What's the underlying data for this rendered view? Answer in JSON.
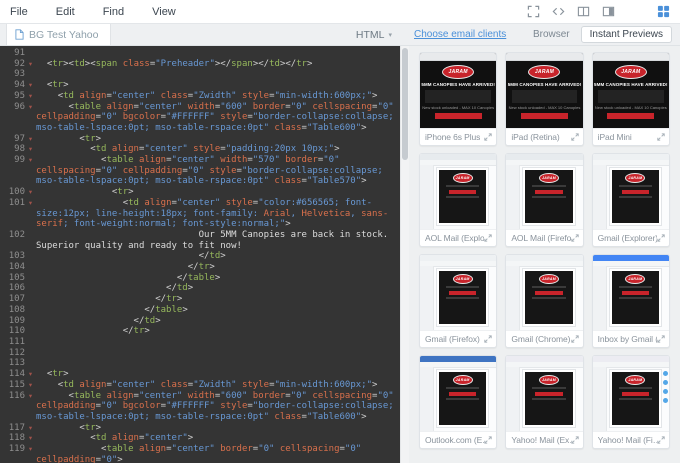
{
  "menubar": {
    "items": [
      "File",
      "Edit",
      "Find",
      "View"
    ],
    "icon_names": [
      "fullscreen-icon",
      "code-view-icon",
      "split-view-icon",
      "layout-view-icon",
      "grid-view-icon"
    ]
  },
  "tabbar": {
    "tab_label": "BG Test Yahoo",
    "mode_label": "HTML"
  },
  "preview_header": {
    "link": "Choose email clients",
    "tabs": [
      {
        "label": "Browser",
        "active": false
      },
      {
        "label": "Instant Previews",
        "active": true
      }
    ]
  },
  "colors": {
    "accent_blue": "#4a90d9",
    "brand_red": "#c8242b",
    "editor_background": "#343434",
    "tag_green": "#96b85c",
    "attribute_orange": "#d9704c",
    "string_blue": "#6898d4"
  },
  "preview_email": {
    "brand": "JARAM",
    "banner": "5MM CANOPIES HAVE ARRIVED!",
    "subbanner": "New stock unloaded - MAX 10 Canopies"
  },
  "previews": [
    {
      "label": "iPhone 6s Plus",
      "type": "device"
    },
    {
      "label": "iPad (Retina)",
      "type": "device"
    },
    {
      "label": "iPad Mini",
      "type": "device"
    },
    {
      "label": "AOL Mail (Explore…",
      "type": "webmail",
      "chrome": "#e7ebee"
    },
    {
      "label": "AOL Mail (Firefox)",
      "type": "webmail",
      "chrome": "#e7ebee"
    },
    {
      "label": "Gmail (Explorer)",
      "type": "webmail",
      "chrome": "#eef1f3"
    },
    {
      "label": "Gmail (Firefox)",
      "type": "webmail",
      "chrome": "#eef1f3"
    },
    {
      "label": "Gmail (Chrome)",
      "type": "webmail",
      "chrome": "#eef1f3"
    },
    {
      "label": "Inbox by Gmail (…",
      "type": "webmail",
      "chrome": "#4285f4"
    },
    {
      "label": "Outlook.com (E…",
      "type": "webmail",
      "chrome": "#3f74c2"
    },
    {
      "label": "Yahoo! Mail (Ex…",
      "type": "webmail",
      "chrome": "#ececf2"
    },
    {
      "label": "Yahoo! Mail (Fi…",
      "type": "webmail",
      "chrome": "#ececf2",
      "dots": true
    }
  ],
  "editor": {
    "lines": [
      {
        "n": 91,
        "t": []
      },
      {
        "n": 92,
        "i": 2,
        "f": true,
        "t": [
          [
            "p",
            "<"
          ],
          [
            "g",
            "tr"
          ],
          [
            "p",
            "><"
          ],
          [
            "g",
            "td"
          ],
          [
            "p",
            "><"
          ],
          [
            "g",
            "span"
          ],
          [
            "p",
            " "
          ],
          [
            "a",
            "class"
          ],
          [
            "p",
            "="
          ],
          [
            "s",
            "\"Preheader\""
          ],
          [
            "p",
            "></"
          ],
          [
            "g",
            "span"
          ],
          [
            "p",
            "></"
          ],
          [
            "g",
            "td"
          ],
          [
            "p",
            "></"
          ],
          [
            "g",
            "tr"
          ],
          [
            "p",
            ">"
          ]
        ]
      },
      {
        "n": 93,
        "t": []
      },
      {
        "n": 94,
        "i": 2,
        "f": true,
        "t": [
          [
            "p",
            "<"
          ],
          [
            "g",
            "tr"
          ],
          [
            "p",
            ">"
          ]
        ]
      },
      {
        "n": 95,
        "i": 4,
        "f": true,
        "t": [
          [
            "p",
            "<"
          ],
          [
            "g",
            "td"
          ],
          [
            "p",
            " "
          ],
          [
            "a",
            "align"
          ],
          [
            "p",
            "="
          ],
          [
            "s",
            "\"center\""
          ],
          [
            "p",
            " "
          ],
          [
            "a",
            "class"
          ],
          [
            "p",
            "="
          ],
          [
            "s",
            "\"Zwidth\""
          ],
          [
            "p",
            " "
          ],
          [
            "a",
            "style"
          ],
          [
            "p",
            "="
          ],
          [
            "s",
            "\"min-width:600px;\""
          ],
          [
            "p",
            ">"
          ]
        ]
      },
      {
        "n": 96,
        "i": 6,
        "f": true,
        "t": [
          [
            "p",
            "<"
          ],
          [
            "g",
            "table"
          ],
          [
            "p",
            " "
          ],
          [
            "a",
            "align"
          ],
          [
            "p",
            "="
          ],
          [
            "s",
            "\"center\""
          ],
          [
            "p",
            " "
          ],
          [
            "a",
            "width"
          ],
          [
            "p",
            "="
          ],
          [
            "s",
            "\"600\""
          ],
          [
            "p",
            " "
          ],
          [
            "a",
            "border"
          ],
          [
            "p",
            "="
          ],
          [
            "s",
            "\"0\""
          ],
          [
            "p",
            " "
          ],
          [
            "a",
            "cellspacing"
          ],
          [
            "p",
            "="
          ],
          [
            "s",
            "\"0\""
          ],
          [
            "p",
            " "
          ],
          [
            "a",
            "cellpadding"
          ],
          [
            "p",
            "="
          ],
          [
            "s",
            "\"0\""
          ],
          [
            "p",
            " "
          ],
          [
            "a",
            "bgcolor"
          ],
          [
            "p",
            "="
          ],
          [
            "s",
            "\"#FFFFFF\""
          ],
          [
            "p",
            " "
          ],
          [
            "a",
            "style"
          ],
          [
            "p",
            "="
          ],
          [
            "s",
            "\"border-collapse:collapse; mso-table-lspace:0pt; mso-table-rspace:0pt\""
          ],
          [
            "p",
            " "
          ],
          [
            "a",
            "class"
          ],
          [
            "p",
            "="
          ],
          [
            "s",
            "\"Table600\""
          ],
          [
            "p",
            ">"
          ]
        ]
      },
      {
        "n": 97,
        "i": 8,
        "f": true,
        "t": [
          [
            "p",
            "<"
          ],
          [
            "g",
            "tr"
          ],
          [
            "p",
            ">"
          ]
        ]
      },
      {
        "n": 98,
        "i": 10,
        "f": true,
        "t": [
          [
            "p",
            "<"
          ],
          [
            "g",
            "td"
          ],
          [
            "p",
            " "
          ],
          [
            "a",
            "align"
          ],
          [
            "p",
            "="
          ],
          [
            "s",
            "\"center\""
          ],
          [
            "p",
            " "
          ],
          [
            "a",
            "style"
          ],
          [
            "p",
            "="
          ],
          [
            "s",
            "\"padding:20px 10px;\""
          ],
          [
            "p",
            ">"
          ]
        ]
      },
      {
        "n": 99,
        "i": 12,
        "f": true,
        "t": [
          [
            "p",
            "<"
          ],
          [
            "g",
            "table"
          ],
          [
            "p",
            " "
          ],
          [
            "a",
            "align"
          ],
          [
            "p",
            "="
          ],
          [
            "s",
            "\"center\""
          ],
          [
            "p",
            " "
          ],
          [
            "a",
            "width"
          ],
          [
            "p",
            "="
          ],
          [
            "s",
            "\"570\""
          ],
          [
            "p",
            " "
          ],
          [
            "a",
            "border"
          ],
          [
            "p",
            "="
          ],
          [
            "s",
            "\"0\""
          ],
          [
            "p",
            " "
          ],
          [
            "a",
            "cellspacing"
          ],
          [
            "p",
            "="
          ],
          [
            "s",
            "\"0\""
          ],
          [
            "p",
            " "
          ],
          [
            "a",
            "cellpadding"
          ],
          [
            "p",
            "="
          ],
          [
            "s",
            "\"0\""
          ],
          [
            "p",
            " "
          ],
          [
            "a",
            "style"
          ],
          [
            "p",
            "="
          ],
          [
            "s",
            "\"border-collapse:collapse; mso-table-lspace:0pt; mso-table-rspace:0pt\""
          ],
          [
            "p",
            " "
          ],
          [
            "a",
            "class"
          ],
          [
            "p",
            "="
          ],
          [
            "s",
            "\"Table570\""
          ],
          [
            "p",
            ">"
          ]
        ]
      },
      {
        "n": 100,
        "i": 14,
        "f": true,
        "t": [
          [
            "p",
            "<"
          ],
          [
            "g",
            "tr"
          ],
          [
            "p",
            ">"
          ]
        ]
      },
      {
        "n": 101,
        "i": 16,
        "f": true,
        "t": [
          [
            "p",
            "<"
          ],
          [
            "g",
            "td"
          ],
          [
            "p",
            " "
          ],
          [
            "a",
            "align"
          ],
          [
            "p",
            "="
          ],
          [
            "s",
            "\"center\""
          ],
          [
            "p",
            " "
          ],
          [
            "a",
            "style"
          ],
          [
            "p",
            "="
          ],
          [
            "s",
            "\"color:#656565; font-size:12px; line-height:18px; font-family: "
          ],
          [
            "c",
            "Arial"
          ],
          [
            "s",
            ", "
          ],
          [
            "c",
            "Helvetica"
          ],
          [
            "s",
            ", "
          ],
          [
            "c",
            "sans-serif"
          ],
          [
            "s",
            "; font-weight:normal; font-style:normal;\""
          ],
          [
            "p",
            ">"
          ]
        ]
      },
      {
        "n": 102,
        "i": 30,
        "t": [
          [
            "x",
            "Our 5MM Canopies are back in stock. Superior quality and ready to fit now!"
          ]
        ]
      },
      {
        "n": 103,
        "i": 30,
        "t": [
          [
            "p",
            "</"
          ],
          [
            "g",
            "td"
          ],
          [
            "p",
            ">"
          ]
        ]
      },
      {
        "n": 104,
        "i": 28,
        "t": [
          [
            "p",
            "</"
          ],
          [
            "g",
            "tr"
          ],
          [
            "p",
            ">"
          ]
        ]
      },
      {
        "n": 105,
        "i": 26,
        "t": [
          [
            "p",
            "</"
          ],
          [
            "g",
            "table"
          ],
          [
            "p",
            ">"
          ]
        ]
      },
      {
        "n": 106,
        "i": 24,
        "t": [
          [
            "p",
            "</"
          ],
          [
            "g",
            "td"
          ],
          [
            "p",
            ">"
          ]
        ]
      },
      {
        "n": 107,
        "i": 22,
        "t": [
          [
            "p",
            "</"
          ],
          [
            "g",
            "tr"
          ],
          [
            "p",
            ">"
          ]
        ]
      },
      {
        "n": 108,
        "i": 20,
        "t": [
          [
            "p",
            "</"
          ],
          [
            "g",
            "table"
          ],
          [
            "p",
            ">"
          ]
        ]
      },
      {
        "n": 109,
        "i": 18,
        "t": [
          [
            "p",
            "</"
          ],
          [
            "g",
            "td"
          ],
          [
            "p",
            ">"
          ]
        ]
      },
      {
        "n": 110,
        "i": 16,
        "t": [
          [
            "p",
            "</"
          ],
          [
            "g",
            "tr"
          ],
          [
            "p",
            ">"
          ]
        ]
      },
      {
        "n": 111,
        "t": []
      },
      {
        "n": 112,
        "t": []
      },
      {
        "n": 113,
        "t": []
      },
      {
        "n": 114,
        "i": 2,
        "f": true,
        "t": [
          [
            "p",
            "<"
          ],
          [
            "g",
            "tr"
          ],
          [
            "p",
            ">"
          ]
        ]
      },
      {
        "n": 115,
        "i": 4,
        "f": true,
        "t": [
          [
            "p",
            "<"
          ],
          [
            "g",
            "td"
          ],
          [
            "p",
            " "
          ],
          [
            "a",
            "align"
          ],
          [
            "p",
            "="
          ],
          [
            "s",
            "\"center\""
          ],
          [
            "p",
            " "
          ],
          [
            "a",
            "class"
          ],
          [
            "p",
            "="
          ],
          [
            "s",
            "\"Zwidth\""
          ],
          [
            "p",
            " "
          ],
          [
            "a",
            "style"
          ],
          [
            "p",
            "="
          ],
          [
            "s",
            "\"min-width:600px;\""
          ],
          [
            "p",
            ">"
          ]
        ]
      },
      {
        "n": 116,
        "i": 6,
        "f": true,
        "t": [
          [
            "p",
            "<"
          ],
          [
            "g",
            "table"
          ],
          [
            "p",
            " "
          ],
          [
            "a",
            "align"
          ],
          [
            "p",
            "="
          ],
          [
            "s",
            "\"center\""
          ],
          [
            "p",
            " "
          ],
          [
            "a",
            "width"
          ],
          [
            "p",
            "="
          ],
          [
            "s",
            "\"600\""
          ],
          [
            "p",
            " "
          ],
          [
            "a",
            "border"
          ],
          [
            "p",
            "="
          ],
          [
            "s",
            "\"0\""
          ],
          [
            "p",
            " "
          ],
          [
            "a",
            "cellspacing"
          ],
          [
            "p",
            "="
          ],
          [
            "s",
            "\"0\""
          ],
          [
            "p",
            " "
          ],
          [
            "a",
            "cellpadding"
          ],
          [
            "p",
            "="
          ],
          [
            "s",
            "\"0\""
          ],
          [
            "p",
            " "
          ],
          [
            "a",
            "bgcolor"
          ],
          [
            "p",
            "="
          ],
          [
            "s",
            "\"#FFFFFF\""
          ],
          [
            "p",
            " "
          ],
          [
            "a",
            "style"
          ],
          [
            "p",
            "="
          ],
          [
            "s",
            "\"border-collapse:collapse; mso-table-lspace:0pt; mso-table-rspace:0pt\""
          ],
          [
            "p",
            " "
          ],
          [
            "a",
            "class"
          ],
          [
            "p",
            "="
          ],
          [
            "s",
            "\"Table600\""
          ],
          [
            "p",
            ">"
          ]
        ]
      },
      {
        "n": 117,
        "i": 8,
        "f": true,
        "t": [
          [
            "p",
            "<"
          ],
          [
            "g",
            "tr"
          ],
          [
            "p",
            ">"
          ]
        ]
      },
      {
        "n": 118,
        "i": 10,
        "f": true,
        "t": [
          [
            "p",
            "<"
          ],
          [
            "g",
            "td"
          ],
          [
            "p",
            " "
          ],
          [
            "a",
            "align"
          ],
          [
            "p",
            "="
          ],
          [
            "s",
            "\"center\""
          ],
          [
            "p",
            ">"
          ]
        ]
      },
      {
        "n": 119,
        "i": 12,
        "f": true,
        "t": [
          [
            "p",
            "<"
          ],
          [
            "g",
            "table"
          ],
          [
            "p",
            " "
          ],
          [
            "a",
            "align"
          ],
          [
            "p",
            "="
          ],
          [
            "s",
            "\"center\""
          ],
          [
            "p",
            " "
          ],
          [
            "a",
            "border"
          ],
          [
            "p",
            "="
          ],
          [
            "s",
            "\"0\""
          ],
          [
            "p",
            " "
          ],
          [
            "a",
            "cellspacing"
          ],
          [
            "p",
            "="
          ],
          [
            "s",
            "\"0\""
          ],
          [
            "p",
            " "
          ],
          [
            "a",
            "cellpadding"
          ],
          [
            "p",
            "="
          ],
          [
            "s",
            "\"0\""
          ],
          [
            "p",
            ">"
          ]
        ]
      }
    ]
  }
}
